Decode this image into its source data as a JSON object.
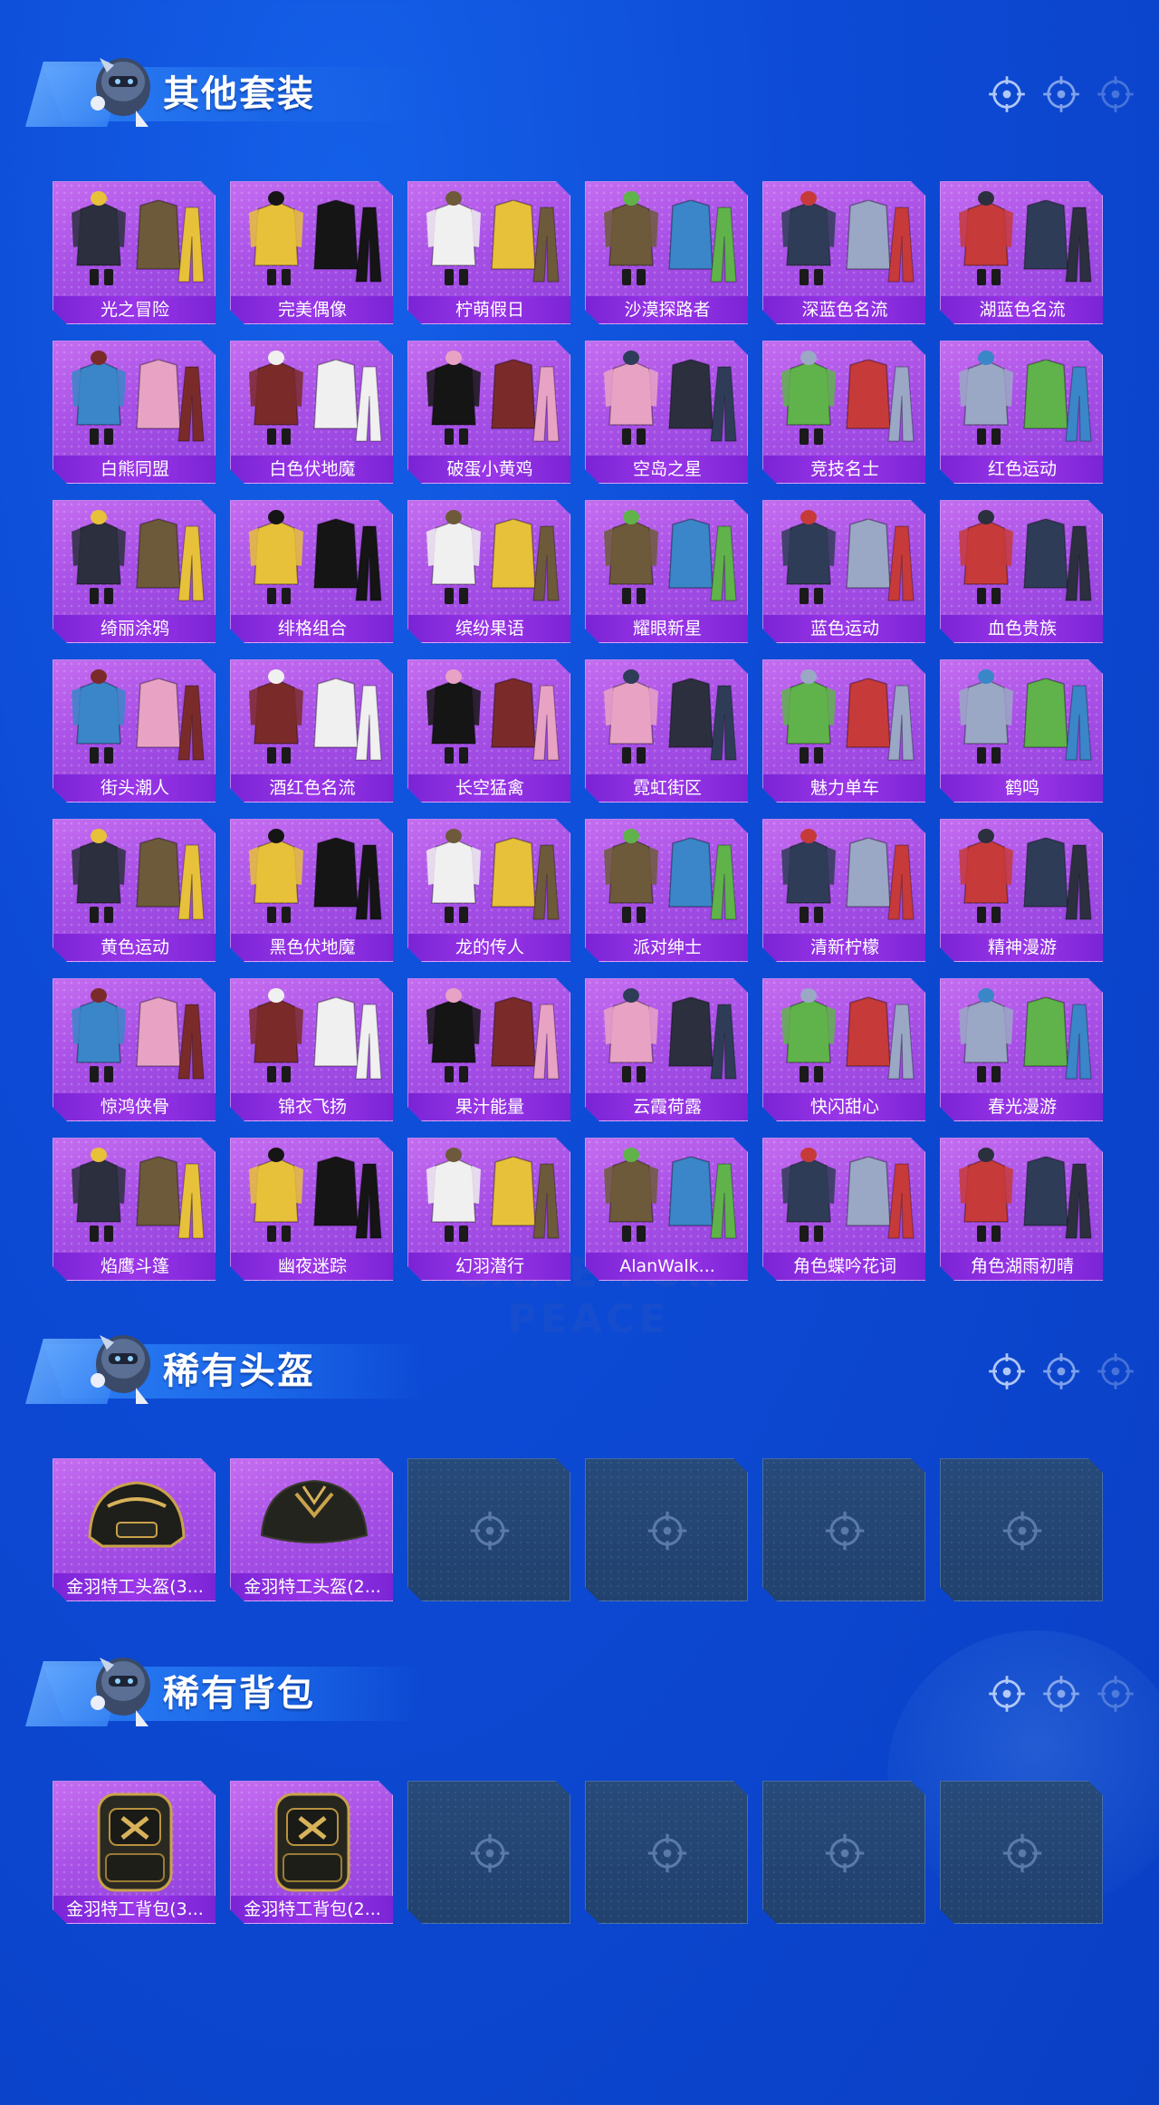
{
  "watermark": "GAME FOR PEACE",
  "colors": {
    "background": "#0d4bd6",
    "tile_purple": "#a850e6",
    "label_bar": "#7a24d6",
    "empty_tile": "#244670"
  },
  "sections": [
    {
      "title": "其他套装",
      "items": [
        "光之冒险",
        "完美偶像",
        "柠萌假日",
        "沙漠探路者",
        "深蓝色名流",
        "湖蓝色名流",
        "白熊同盟",
        "白色伏地魔",
        "破蛋小黄鸡",
        "空岛之星",
        "竞技名士",
        "红色运动",
        "绮丽涂鸦",
        "绯格组合",
        "缤纷果语",
        "耀眼新星",
        "蓝色运动",
        "血色贵族",
        "街头潮人",
        "酒红色名流",
        "长空猛禽",
        "霓虹街区",
        "魅力单车",
        "鹤鸣",
        "黄色运动",
        "黑色伏地魔",
        "龙的传人",
        "派对绅士",
        "清新柠檬",
        "精神漫游",
        "惊鸿侠骨",
        "锦衣飞扬",
        "果汁能量",
        "云霞荷露",
        "快闪甜心",
        "春光漫游",
        "焰鹰斗篷",
        "幽夜迷踪",
        "幻羽潜行",
        "AlanWalk...",
        "角色蝶吟花词",
        "角色湖雨初晴"
      ],
      "empty_slots": 0
    },
    {
      "title": "稀有头盔",
      "items": [
        "金羽特工头盔(3...",
        "金羽特工头盔(2..."
      ],
      "empty_slots": 4
    },
    {
      "title": "稀有背包",
      "items": [
        "金羽特工背包(3...",
        "金羽特工背包(2..."
      ],
      "empty_slots": 4
    }
  ]
}
